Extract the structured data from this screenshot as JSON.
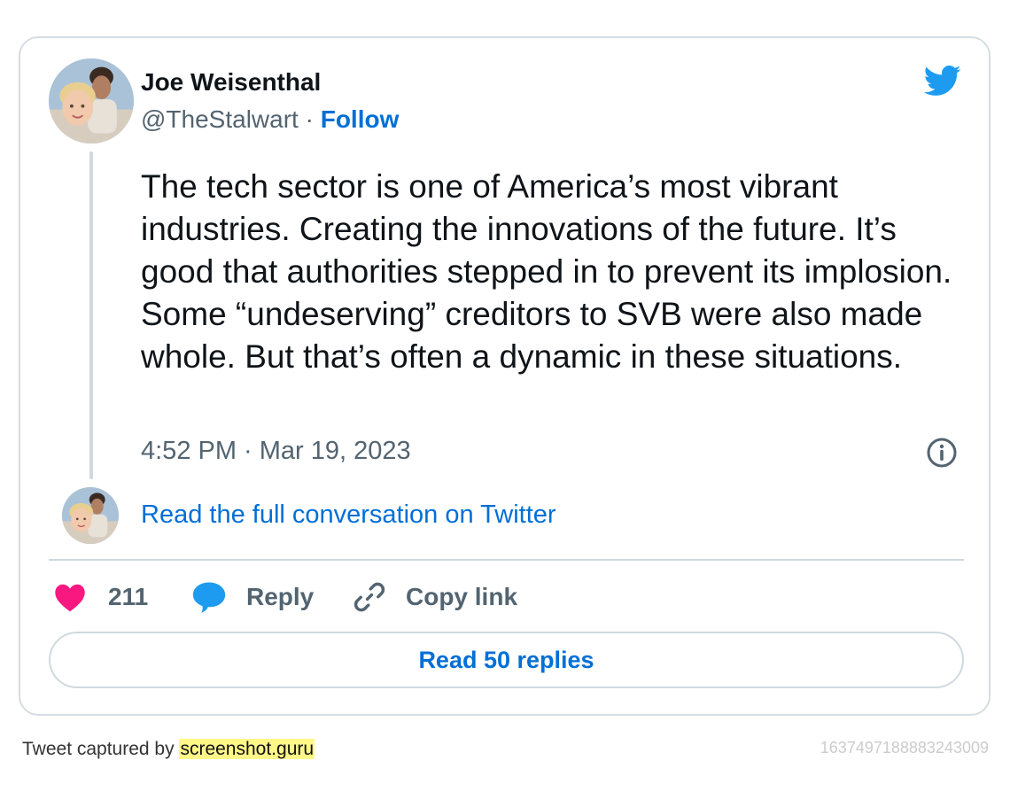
{
  "author": {
    "name": "Joe Weisenthal",
    "handle": "@TheStalwart",
    "separator": "·",
    "follow_label": "Follow"
  },
  "tweet": {
    "text": "The tech sector is one of America’s most vibrant industries. Creating the innovations of the future. It’s good that authorities stepped in to prevent its implosion. Some “undeserving” creditors to SVB were also made whole. But that’s often a dynamic in these situations.",
    "timestamp": "4:52 PM · Mar 19, 2023"
  },
  "conversation": {
    "link_label": "Read the full conversation on Twitter"
  },
  "actions": {
    "like_count": "211",
    "reply_label": "Reply",
    "copy_label": "Copy link"
  },
  "replies_button": {
    "label": "Read 50 replies"
  },
  "footer": {
    "captured_by": "Tweet captured by",
    "link_label": "screenshot.guru",
    "tweet_id": "1637497188883243009"
  },
  "icons": {
    "brand": "twitter-bird-icon",
    "info": "info-icon",
    "like": "heart-icon",
    "reply": "speech-bubble-icon",
    "copy": "link-icon"
  },
  "colors": {
    "accent_blue": "#006fd6",
    "twitter_blue": "#1d9bf0",
    "heart_pink": "#f91880",
    "text_primary": "#0f1419",
    "text_secondary": "#536471",
    "border": "#cfd9de",
    "highlight": "#fff788"
  }
}
